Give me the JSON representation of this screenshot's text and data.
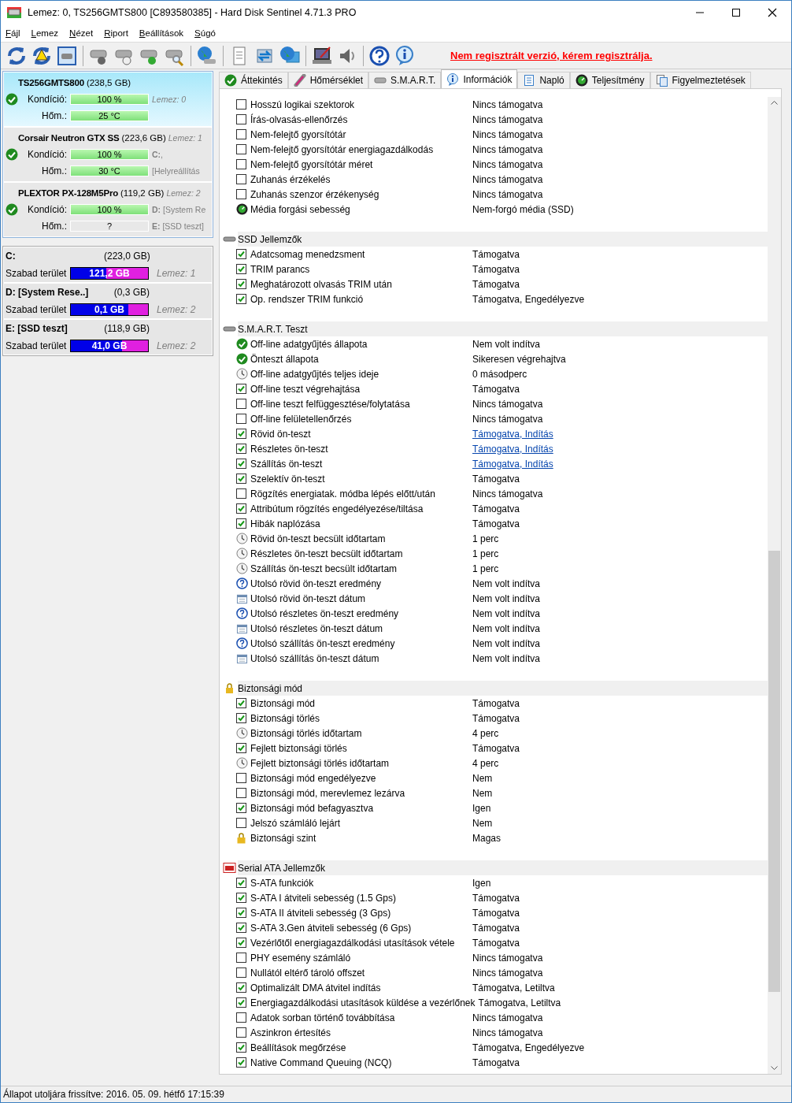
{
  "window": {
    "title": "Lemez: 0, TS256GMTS800 [C893580385]  -  Hard Disk Sentinel 4.71.3 PRO"
  },
  "menu": [
    "Fájl",
    "Lemez",
    "Nézet",
    "Riport",
    "Beállítások",
    "Súgó"
  ],
  "register_link": "Nem regisztrált verzió, kérem regisztrálja.",
  "disks": [
    {
      "name": "TS256GMTS800",
      "size": "(238,5 GB)",
      "selected": true,
      "condition": {
        "label": "Kondíció:",
        "reading": "100 %",
        "level": 1
      },
      "condition_side": "Lemez: 0",
      "temperature": {
        "label": "Hőm.:",
        "reading": "25 °C",
        "level": 1
      }
    },
    {
      "name": "Corsair Neutron GTX SS",
      "size": "(223,6 GB)",
      "selected": false,
      "name_side": "Lemez: 1",
      "condition": {
        "label": "Kondíció:",
        "reading": "100 %",
        "level": 1
      },
      "condition_side": "**C:**,",
      "temperature": {
        "label": "Hőm.:",
        "reading": "30 °C",
        "level": 1
      },
      "temperature_side": "[Helyreállítás"
    },
    {
      "name": "PLEXTOR PX-128M5Pro",
      "size": "(119,2 GB)",
      "selected": false,
      "name_side": "Lemez: 2",
      "condition": {
        "label": "Kondíció:",
        "reading": "100 %",
        "level": 1
      },
      "condition_side": "**D:** [System Re",
      "temperature": {
        "label": "Hőm.:",
        "reading": "?"
      },
      "temperature_side": "**E:** [SSD teszt]"
    }
  ],
  "partitions": [
    {
      "name": "C:",
      "size": "(223,0 GB)",
      "label": "Szabad terület",
      "free": "121,2 GB",
      "level": 0.46,
      "disk": "Lemez: 1"
    },
    {
      "name": "D: [System Rese..]",
      "size": "(0,3 GB)",
      "label": "Szabad terület",
      "free": "0,1 GB",
      "level": 0.74,
      "disk": "Lemez: 2"
    },
    {
      "name": "E: [SSD teszt]",
      "size": "(118,9 GB)",
      "label": "Szabad terület",
      "free": "41,0 GB",
      "level": 0.66,
      "disk": "Lemez: 2"
    }
  ],
  "tabs": [
    {
      "label": "Áttekintés",
      "selected": false
    },
    {
      "label": "Hőmérséklet",
      "selected": false
    },
    {
      "label": "S.M.A.R.T.",
      "selected": false
    },
    {
      "label": "Információk",
      "selected": true
    },
    {
      "label": "Napló",
      "selected": false
    },
    {
      "label": "Teljesítmény",
      "selected": false
    },
    {
      "label": "Figyelmeztetések",
      "selected": false
    }
  ],
  "sections": [
    {
      "rows": [
        {
          "kind": "checkbox",
          "checked": false,
          "label": "Hosszú logikai szektorok",
          "value": "Nincs támogatva"
        },
        {
          "kind": "checkbox",
          "checked": false,
          "label": "Írás-olvasás-ellenőrzés",
          "value": "Nincs támogatva"
        },
        {
          "kind": "checkbox",
          "checked": false,
          "label": "Nem-felejtő gyorsítótár",
          "value": "Nincs támogatva"
        },
        {
          "kind": "checkbox",
          "checked": false,
          "label": "Nem-felejtő gyorsítótár energiagazdálkodás",
          "value": "Nincs támogatva"
        },
        {
          "kind": "checkbox",
          "checked": false,
          "label": "Nem-felejtő gyorsítótár méret",
          "value": "Nincs támogatva"
        },
        {
          "kind": "checkbox",
          "checked": false,
          "label": "Zuhanás érzékelés",
          "value": "Nincs támogatva"
        },
        {
          "kind": "checkbox",
          "checked": false,
          "label": "Zuhanás szenzor érzékenység",
          "value": "Nincs támogatva"
        },
        {
          "kind": "gauge",
          "label": "Média forgási sebesség",
          "value": "Nem-forgó média (SSD)"
        }
      ]
    },
    {
      "title": "SSD Jellemzők",
      "rows": [
        {
          "kind": "checkbox",
          "checked": true,
          "label": "Adatcsomag menedzsment",
          "value": "Támogatva"
        },
        {
          "kind": "checkbox",
          "checked": true,
          "label": "TRIM parancs",
          "value": "Támogatva"
        },
        {
          "kind": "checkbox",
          "checked": true,
          "label": "Meghatározott olvasás TRIM után",
          "value": "Támogatva"
        },
        {
          "kind": "checkbox",
          "checked": true,
          "label": "Op. rendszer TRIM funkció",
          "value": "Támogatva, Engedélyezve"
        }
      ]
    },
    {
      "title": "S.M.A.R.T. Teszt",
      "rows": [
        {
          "kind": "ok",
          "label": "Off-line adatgyűjtés állapota",
          "value": "Nem volt indítva"
        },
        {
          "kind": "ok",
          "label": "Önteszt állapota",
          "value": "Sikeresen végrehajtva"
        },
        {
          "kind": "clock",
          "label": "Off-line adatgyűjtés teljes ideje",
          "value": "0 másodperc"
        },
        {
          "kind": "checkbox",
          "checked": true,
          "label": "Off-line teszt végrehajtása",
          "value": "Támogatva"
        },
        {
          "kind": "checkbox",
          "checked": false,
          "label": "Off-line teszt felfüggesztése/folytatása",
          "value": "Nincs támogatva"
        },
        {
          "kind": "checkbox",
          "checked": false,
          "label": "Off-line felületellenőrzés",
          "value": "Nincs támogatva"
        },
        {
          "kind": "checkbox",
          "checked": true,
          "label": "Rövid ön-teszt",
          "value": "Támogatva, Indítás",
          "link": true
        },
        {
          "kind": "checkbox",
          "checked": true,
          "label": "Részletes ön-teszt",
          "value": "Támogatva, Indítás",
          "link": true
        },
        {
          "kind": "checkbox",
          "checked": true,
          "label": "Szállítás ön-teszt",
          "value": "Támogatva, Indítás",
          "link": true
        },
        {
          "kind": "checkbox",
          "checked": true,
          "label": "Szelektív ön-teszt",
          "value": "Támogatva"
        },
        {
          "kind": "checkbox",
          "checked": false,
          "label": "Rögzítés energiatak. módba lépés előtt/után",
          "value": "Nincs támogatva"
        },
        {
          "kind": "checkbox",
          "checked": true,
          "label": "Attribútum rögzítés engedélyezése/tiltása",
          "value": "Támogatva"
        },
        {
          "kind": "checkbox",
          "checked": true,
          "label": "Hibák naplózása",
          "value": "Támogatva"
        },
        {
          "kind": "clock",
          "label": "Rövid ön-teszt becsült időtartam",
          "value": "1 perc"
        },
        {
          "kind": "clock",
          "label": "Részletes ön-teszt becsült időtartam",
          "value": "1 perc"
        },
        {
          "kind": "clock",
          "label": "Szállítás ön-teszt becsült időtartam",
          "value": "1 perc"
        },
        {
          "kind": "question",
          "label": "Utolsó rövid ön-teszt eredmény",
          "value": "Nem volt indítva"
        },
        {
          "kind": "calendar",
          "label": "Utolsó rövid ön-teszt dátum",
          "value": "Nem volt indítva"
        },
        {
          "kind": "question",
          "label": "Utolsó részletes ön-teszt eredmény",
          "value": "Nem volt indítva"
        },
        {
          "kind": "calendar",
          "label": "Utolsó részletes ön-teszt dátum",
          "value": "Nem volt indítva"
        },
        {
          "kind": "question",
          "label": "Utolsó szállítás ön-teszt eredmény",
          "value": "Nem volt indítva"
        },
        {
          "kind": "calendar",
          "label": "Utolsó szállítás ön-teszt dátum",
          "value": "Nem volt indítva"
        }
      ]
    },
    {
      "title": "Biztonsági mód",
      "rows": [
        {
          "kind": "checkbox",
          "checked": true,
          "label": "Biztonsági mód",
          "value": "Támogatva"
        },
        {
          "kind": "checkbox",
          "checked": true,
          "label": "Biztonsági törlés",
          "value": "Támogatva"
        },
        {
          "kind": "clock",
          "label": "Biztonsági törlés időtartam",
          "value": "4 perc"
        },
        {
          "kind": "checkbox",
          "checked": true,
          "label": "Fejlett biztonsági törlés",
          "value": "Támogatva"
        },
        {
          "kind": "clock",
          "label": "Fejlett biztonsági törlés időtartam",
          "value": "4 perc"
        },
        {
          "kind": "checkbox",
          "checked": false,
          "label": "Biztonsági mód engedélyezve",
          "value": "Nem"
        },
        {
          "kind": "checkbox",
          "checked": false,
          "label": "Biztonsági mód, merevlemez lezárva",
          "value": "Nem"
        },
        {
          "kind": "checkbox",
          "checked": true,
          "label": "Biztonsági mód befagyasztva",
          "value": "Igen"
        },
        {
          "kind": "checkbox",
          "checked": false,
          "label": "Jelszó számláló lejárt",
          "value": "Nem"
        },
        {
          "kind": "lock",
          "label": "Biztonsági szint",
          "value": "Magas"
        }
      ]
    },
    {
      "title": "Serial ATA Jellemzők",
      "rows": [
        {
          "kind": "checkbox",
          "checked": true,
          "label": "S-ATA funkciók",
          "value": "Igen"
        },
        {
          "kind": "checkbox",
          "checked": true,
          "label": "S-ATA I átviteli sebesség (1.5 Gps)",
          "value": "Támogatva"
        },
        {
          "kind": "checkbox",
          "checked": true,
          "label": "S-ATA II átviteli sebesség (3 Gps)",
          "value": "Támogatva"
        },
        {
          "kind": "checkbox",
          "checked": true,
          "label": "S-ATA 3.Gen átviteli sebesség (6 Gps)",
          "value": "Támogatva"
        },
        {
          "kind": "checkbox",
          "checked": true,
          "label": "Vezérlőtől energiagazdálkodási utasítások vétele",
          "value": "Támogatva"
        },
        {
          "kind": "checkbox",
          "checked": false,
          "label": "PHY esemény számláló",
          "value": "Nincs támogatva"
        },
        {
          "kind": "checkbox",
          "checked": false,
          "label": "Nullától eltérő tároló offszet",
          "value": "Nincs támogatva"
        },
        {
          "kind": "checkbox",
          "checked": true,
          "label": "Optimalizált DMA átvitel indítás",
          "value": "Támogatva, Letiltva"
        },
        {
          "kind": "checkbox",
          "checked": true,
          "label": "Energiagazdálkodási utasítások küldése a vezérlőnek",
          "value": "Támogatva, Letiltva"
        },
        {
          "kind": "checkbox",
          "checked": false,
          "label": "Adatok sorban történő továbbítása",
          "value": "Nincs támogatva"
        },
        {
          "kind": "checkbox",
          "checked": false,
          "label": "Aszinkron értesítés",
          "value": "Nincs támogatva"
        },
        {
          "kind": "checkbox",
          "checked": true,
          "label": "Beállítások megőrzése",
          "value": "Támogatva, Engedélyezve"
        },
        {
          "kind": "checkbox",
          "checked": true,
          "label": "Native Command Queuing (NCQ)",
          "value": "Támogatva"
        }
      ]
    }
  ],
  "status_bar": "Állapot utoljára frissítve: 2016. 05. 09. hétfő 17:15:39"
}
